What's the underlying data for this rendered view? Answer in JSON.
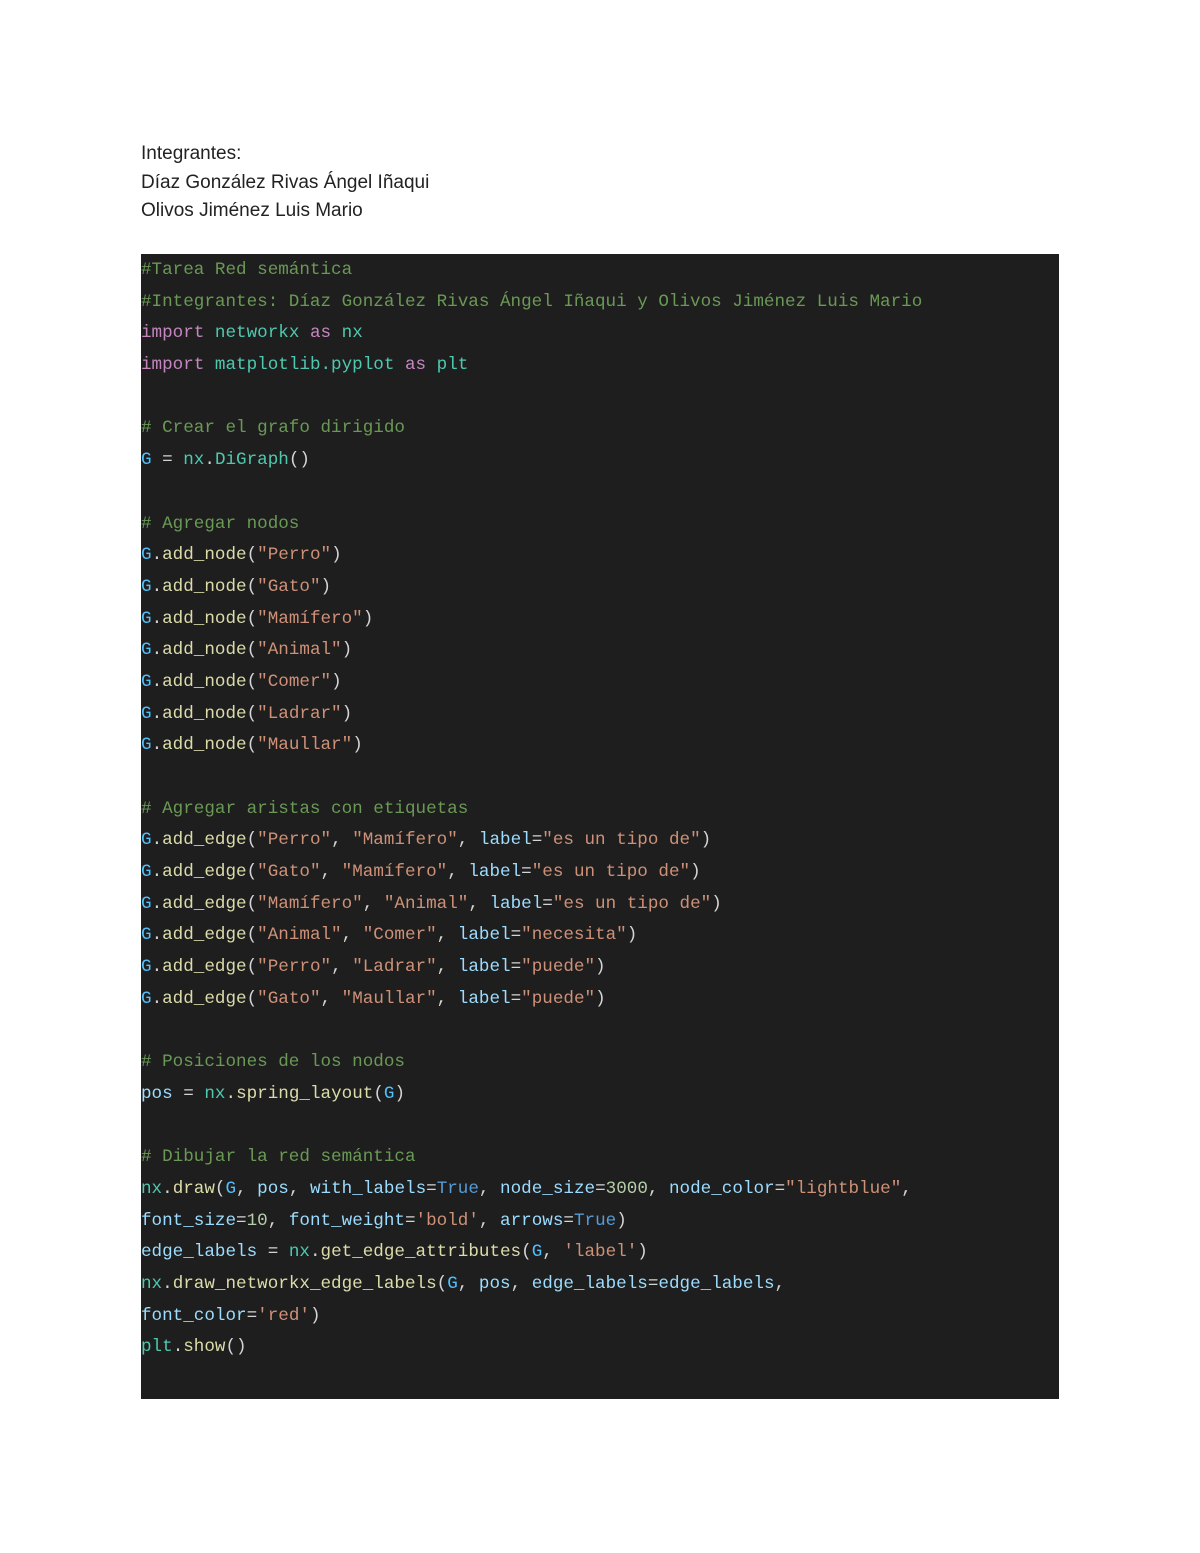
{
  "header": {
    "lines": [
      "Integrantes:",
      "Díaz González Rivas Ángel Iñaqui",
      "Olivos Jiménez Luis Mario"
    ]
  },
  "code": {
    "lines": [
      [
        {
          "t": "comment",
          "v": "#Tarea Red semántica"
        }
      ],
      [
        {
          "t": "comment",
          "v": "#Integrantes: Díaz González Rivas Ángel Iñaqui y Olivos Jiménez Luis Mario"
        }
      ],
      [
        {
          "t": "keyword",
          "v": "import"
        },
        {
          "t": "plain",
          "v": " "
        },
        {
          "t": "module",
          "v": "networkx"
        },
        {
          "t": "plain",
          "v": " "
        },
        {
          "t": "keyword",
          "v": "as"
        },
        {
          "t": "plain",
          "v": " "
        },
        {
          "t": "module",
          "v": "nx"
        }
      ],
      [
        {
          "t": "keyword",
          "v": "import"
        },
        {
          "t": "plain",
          "v": " "
        },
        {
          "t": "module",
          "v": "matplotlib.pyplot"
        },
        {
          "t": "plain",
          "v": " "
        },
        {
          "t": "keyword",
          "v": "as"
        },
        {
          "t": "plain",
          "v": " "
        },
        {
          "t": "module",
          "v": "plt"
        }
      ],
      [],
      [
        {
          "t": "comment",
          "v": "# Crear el grafo dirigido"
        }
      ],
      [
        {
          "t": "var",
          "v": "G"
        },
        {
          "t": "plain",
          "v": " = "
        },
        {
          "t": "module",
          "v": "nx"
        },
        {
          "t": "plain",
          "v": "."
        },
        {
          "t": "module",
          "v": "DiGraph"
        },
        {
          "t": "plain",
          "v": "()"
        }
      ],
      [],
      [
        {
          "t": "comment",
          "v": "# Agregar nodos"
        }
      ],
      [
        {
          "t": "var",
          "v": "G"
        },
        {
          "t": "plain",
          "v": "."
        },
        {
          "t": "func",
          "v": "add_node"
        },
        {
          "t": "plain",
          "v": "("
        },
        {
          "t": "string",
          "v": "\"Perro\""
        },
        {
          "t": "plain",
          "v": ")"
        }
      ],
      [
        {
          "t": "var",
          "v": "G"
        },
        {
          "t": "plain",
          "v": "."
        },
        {
          "t": "func",
          "v": "add_node"
        },
        {
          "t": "plain",
          "v": "("
        },
        {
          "t": "string",
          "v": "\"Gato\""
        },
        {
          "t": "plain",
          "v": ")"
        }
      ],
      [
        {
          "t": "var",
          "v": "G"
        },
        {
          "t": "plain",
          "v": "."
        },
        {
          "t": "func",
          "v": "add_node"
        },
        {
          "t": "plain",
          "v": "("
        },
        {
          "t": "string",
          "v": "\"Mamífero\""
        },
        {
          "t": "plain",
          "v": ")"
        }
      ],
      [
        {
          "t": "var",
          "v": "G"
        },
        {
          "t": "plain",
          "v": "."
        },
        {
          "t": "func",
          "v": "add_node"
        },
        {
          "t": "plain",
          "v": "("
        },
        {
          "t": "string",
          "v": "\"Animal\""
        },
        {
          "t": "plain",
          "v": ")"
        }
      ],
      [
        {
          "t": "var",
          "v": "G"
        },
        {
          "t": "plain",
          "v": "."
        },
        {
          "t": "func",
          "v": "add_node"
        },
        {
          "t": "plain",
          "v": "("
        },
        {
          "t": "string",
          "v": "\"Comer\""
        },
        {
          "t": "plain",
          "v": ")"
        }
      ],
      [
        {
          "t": "var",
          "v": "G"
        },
        {
          "t": "plain",
          "v": "."
        },
        {
          "t": "func",
          "v": "add_node"
        },
        {
          "t": "plain",
          "v": "("
        },
        {
          "t": "string",
          "v": "\"Ladrar\""
        },
        {
          "t": "plain",
          "v": ")"
        }
      ],
      [
        {
          "t": "var",
          "v": "G"
        },
        {
          "t": "plain",
          "v": "."
        },
        {
          "t": "func",
          "v": "add_node"
        },
        {
          "t": "plain",
          "v": "("
        },
        {
          "t": "string",
          "v": "\"Maullar\""
        },
        {
          "t": "plain",
          "v": ")"
        }
      ],
      [],
      [
        {
          "t": "comment",
          "v": "# Agregar aristas con etiquetas"
        }
      ],
      [
        {
          "t": "var",
          "v": "G"
        },
        {
          "t": "plain",
          "v": "."
        },
        {
          "t": "func",
          "v": "add_edge"
        },
        {
          "t": "plain",
          "v": "("
        },
        {
          "t": "string",
          "v": "\"Perro\""
        },
        {
          "t": "plain",
          "v": ", "
        },
        {
          "t": "string",
          "v": "\"Mamífero\""
        },
        {
          "t": "plain",
          "v": ", "
        },
        {
          "t": "ident",
          "v": "label"
        },
        {
          "t": "plain",
          "v": "="
        },
        {
          "t": "string",
          "v": "\"es un tipo de\""
        },
        {
          "t": "plain",
          "v": ")"
        }
      ],
      [
        {
          "t": "var",
          "v": "G"
        },
        {
          "t": "plain",
          "v": "."
        },
        {
          "t": "func",
          "v": "add_edge"
        },
        {
          "t": "plain",
          "v": "("
        },
        {
          "t": "string",
          "v": "\"Gato\""
        },
        {
          "t": "plain",
          "v": ", "
        },
        {
          "t": "string",
          "v": "\"Mamífero\""
        },
        {
          "t": "plain",
          "v": ", "
        },
        {
          "t": "ident",
          "v": "label"
        },
        {
          "t": "plain",
          "v": "="
        },
        {
          "t": "string",
          "v": "\"es un tipo de\""
        },
        {
          "t": "plain",
          "v": ")"
        }
      ],
      [
        {
          "t": "var",
          "v": "G"
        },
        {
          "t": "plain",
          "v": "."
        },
        {
          "t": "func",
          "v": "add_edge"
        },
        {
          "t": "plain",
          "v": "("
        },
        {
          "t": "string",
          "v": "\"Mamífero\""
        },
        {
          "t": "plain",
          "v": ", "
        },
        {
          "t": "string",
          "v": "\"Animal\""
        },
        {
          "t": "plain",
          "v": ", "
        },
        {
          "t": "ident",
          "v": "label"
        },
        {
          "t": "plain",
          "v": "="
        },
        {
          "t": "string",
          "v": "\"es un tipo de\""
        },
        {
          "t": "plain",
          "v": ")"
        }
      ],
      [
        {
          "t": "var",
          "v": "G"
        },
        {
          "t": "plain",
          "v": "."
        },
        {
          "t": "func",
          "v": "add_edge"
        },
        {
          "t": "plain",
          "v": "("
        },
        {
          "t": "string",
          "v": "\"Animal\""
        },
        {
          "t": "plain",
          "v": ", "
        },
        {
          "t": "string",
          "v": "\"Comer\""
        },
        {
          "t": "plain",
          "v": ", "
        },
        {
          "t": "ident",
          "v": "label"
        },
        {
          "t": "plain",
          "v": "="
        },
        {
          "t": "string",
          "v": "\"necesita\""
        },
        {
          "t": "plain",
          "v": ")"
        }
      ],
      [
        {
          "t": "var",
          "v": "G"
        },
        {
          "t": "plain",
          "v": "."
        },
        {
          "t": "func",
          "v": "add_edge"
        },
        {
          "t": "plain",
          "v": "("
        },
        {
          "t": "string",
          "v": "\"Perro\""
        },
        {
          "t": "plain",
          "v": ", "
        },
        {
          "t": "string",
          "v": "\"Ladrar\""
        },
        {
          "t": "plain",
          "v": ", "
        },
        {
          "t": "ident",
          "v": "label"
        },
        {
          "t": "plain",
          "v": "="
        },
        {
          "t": "string",
          "v": "\"puede\""
        },
        {
          "t": "plain",
          "v": ")"
        }
      ],
      [
        {
          "t": "var",
          "v": "G"
        },
        {
          "t": "plain",
          "v": "."
        },
        {
          "t": "func",
          "v": "add_edge"
        },
        {
          "t": "plain",
          "v": "("
        },
        {
          "t": "string",
          "v": "\"Gato\""
        },
        {
          "t": "plain",
          "v": ", "
        },
        {
          "t": "string",
          "v": "\"Maullar\""
        },
        {
          "t": "plain",
          "v": ", "
        },
        {
          "t": "ident",
          "v": "label"
        },
        {
          "t": "plain",
          "v": "="
        },
        {
          "t": "string",
          "v": "\"puede\""
        },
        {
          "t": "plain",
          "v": ")"
        }
      ],
      [],
      [
        {
          "t": "comment",
          "v": "# Posiciones de los nodos"
        }
      ],
      [
        {
          "t": "ident",
          "v": "pos"
        },
        {
          "t": "plain",
          "v": " = "
        },
        {
          "t": "module",
          "v": "nx"
        },
        {
          "t": "plain",
          "v": "."
        },
        {
          "t": "func",
          "v": "spring_layout"
        },
        {
          "t": "plain",
          "v": "("
        },
        {
          "t": "var",
          "v": "G"
        },
        {
          "t": "plain",
          "v": ")"
        }
      ],
      [],
      [
        {
          "t": "comment",
          "v": "# Dibujar la red semántica"
        }
      ],
      [
        {
          "t": "module",
          "v": "nx"
        },
        {
          "t": "plain",
          "v": "."
        },
        {
          "t": "func",
          "v": "draw"
        },
        {
          "t": "plain",
          "v": "("
        },
        {
          "t": "var",
          "v": "G"
        },
        {
          "t": "plain",
          "v": ", "
        },
        {
          "t": "ident",
          "v": "pos"
        },
        {
          "t": "plain",
          "v": ", "
        },
        {
          "t": "ident",
          "v": "with_labels"
        },
        {
          "t": "plain",
          "v": "="
        },
        {
          "t": "const",
          "v": "True"
        },
        {
          "t": "plain",
          "v": ", "
        },
        {
          "t": "ident",
          "v": "node_size"
        },
        {
          "t": "plain",
          "v": "="
        },
        {
          "t": "number",
          "v": "3000"
        },
        {
          "t": "plain",
          "v": ", "
        },
        {
          "t": "ident",
          "v": "node_color"
        },
        {
          "t": "plain",
          "v": "="
        },
        {
          "t": "string",
          "v": "\"lightblue\""
        },
        {
          "t": "plain",
          "v": ","
        }
      ],
      [
        {
          "t": "ident",
          "v": "font_size"
        },
        {
          "t": "plain",
          "v": "="
        },
        {
          "t": "number",
          "v": "10"
        },
        {
          "t": "plain",
          "v": ", "
        },
        {
          "t": "ident",
          "v": "font_weight"
        },
        {
          "t": "plain",
          "v": "="
        },
        {
          "t": "string",
          "v": "'bold'"
        },
        {
          "t": "plain",
          "v": ", "
        },
        {
          "t": "ident",
          "v": "arrows"
        },
        {
          "t": "plain",
          "v": "="
        },
        {
          "t": "const",
          "v": "True"
        },
        {
          "t": "plain",
          "v": ")"
        }
      ],
      [
        {
          "t": "ident",
          "v": "edge_labels"
        },
        {
          "t": "plain",
          "v": " = "
        },
        {
          "t": "module",
          "v": "nx"
        },
        {
          "t": "plain",
          "v": "."
        },
        {
          "t": "func",
          "v": "get_edge_attributes"
        },
        {
          "t": "plain",
          "v": "("
        },
        {
          "t": "var",
          "v": "G"
        },
        {
          "t": "plain",
          "v": ", "
        },
        {
          "t": "string",
          "v": "'label'"
        },
        {
          "t": "plain",
          "v": ")"
        }
      ],
      [
        {
          "t": "module",
          "v": "nx"
        },
        {
          "t": "plain",
          "v": "."
        },
        {
          "t": "func",
          "v": "draw_networkx_edge_labels"
        },
        {
          "t": "plain",
          "v": "("
        },
        {
          "t": "var",
          "v": "G"
        },
        {
          "t": "plain",
          "v": ", "
        },
        {
          "t": "ident",
          "v": "pos"
        },
        {
          "t": "plain",
          "v": ", "
        },
        {
          "t": "ident",
          "v": "edge_labels"
        },
        {
          "t": "plain",
          "v": "="
        },
        {
          "t": "ident",
          "v": "edge_labels"
        },
        {
          "t": "plain",
          "v": ","
        }
      ],
      [
        {
          "t": "ident",
          "v": "font_color"
        },
        {
          "t": "plain",
          "v": "="
        },
        {
          "t": "string",
          "v": "'red'"
        },
        {
          "t": "plain",
          "v": ")"
        }
      ],
      [
        {
          "t": "module",
          "v": "plt"
        },
        {
          "t": "plain",
          "v": "."
        },
        {
          "t": "func",
          "v": "show"
        },
        {
          "t": "plain",
          "v": "()"
        }
      ]
    ]
  }
}
